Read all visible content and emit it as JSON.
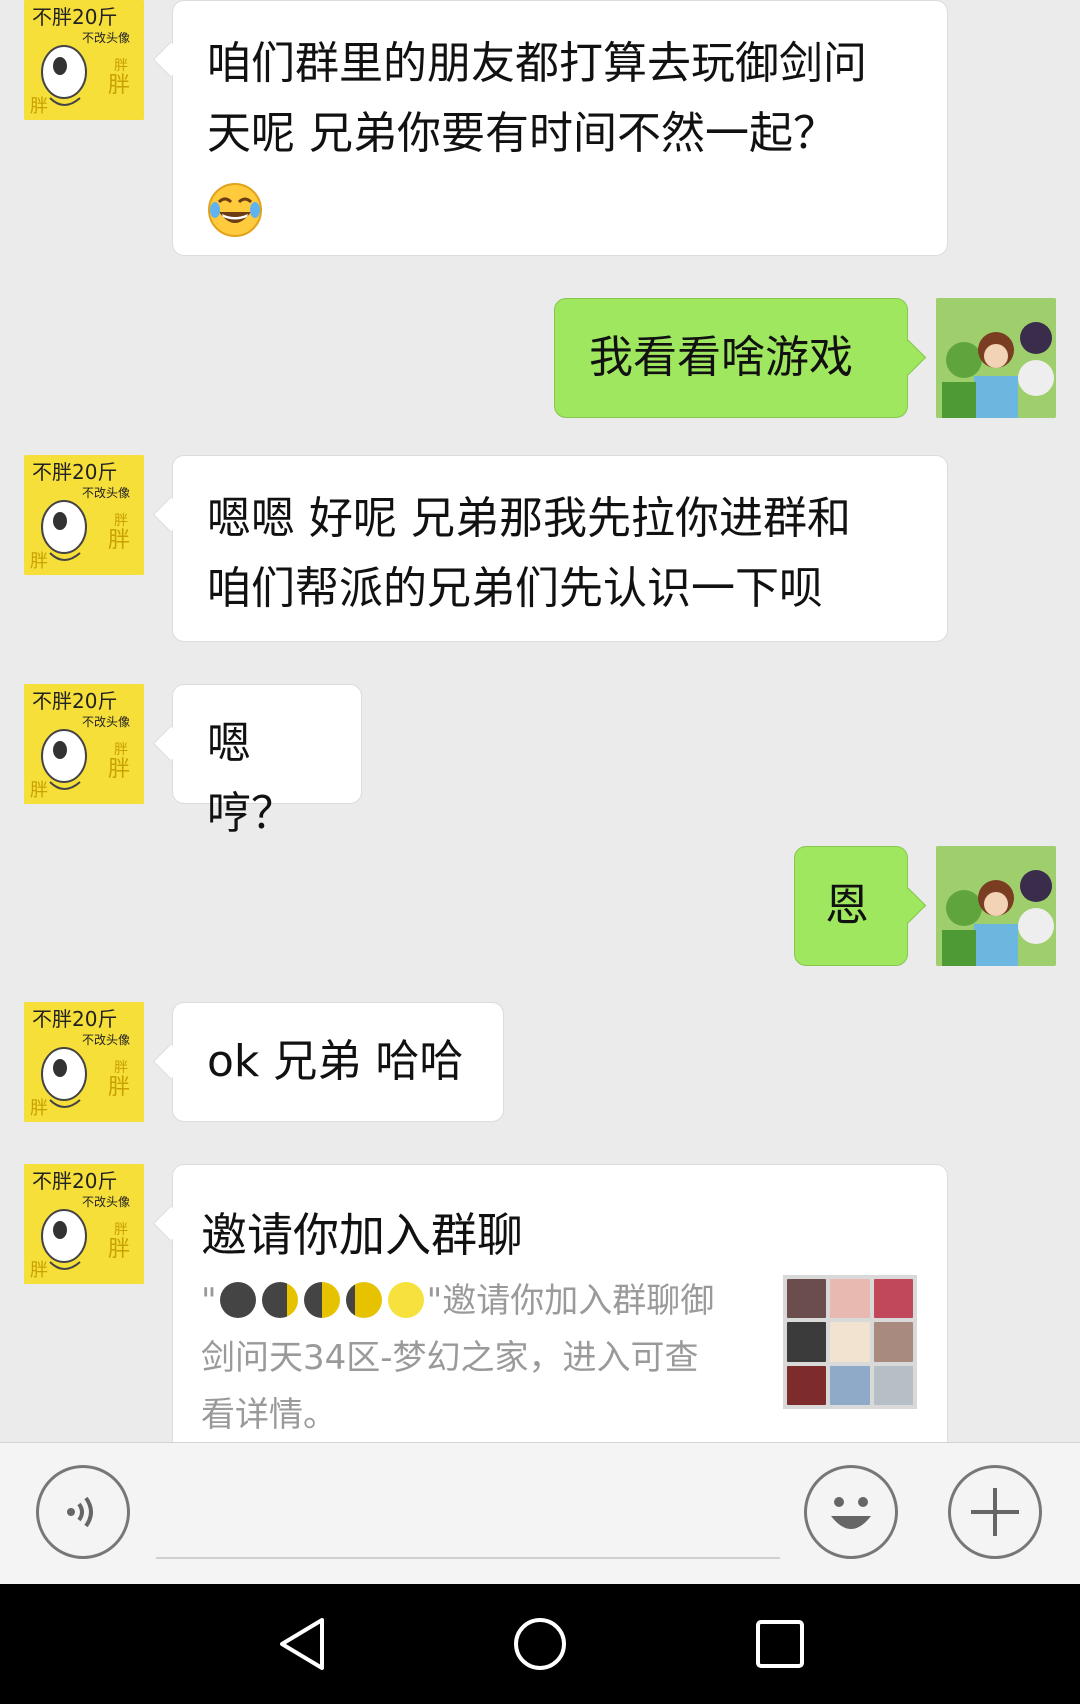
{
  "messages": [
    {
      "sender": "friend",
      "text_line1": "咱们群里的朋友都打算去玩御剑问",
      "text_line2": "天呢  兄弟你要有时间不然一起？",
      "emoji": "face-with-tears-of-joy-icon"
    },
    {
      "sender": "me",
      "text": "我看看啥游戏"
    },
    {
      "sender": "friend",
      "text_line1": "嗯嗯 好呢  兄弟那我先拉你进群和",
      "text_line2": "咱们帮派的兄弟们先认识一下呗"
    },
    {
      "sender": "friend",
      "text": "嗯哼？"
    },
    {
      "sender": "me",
      "text": "恩"
    },
    {
      "sender": "friend",
      "text": "ok 兄弟 哈哈"
    }
  ],
  "friend_avatar": {
    "line1": "不胖20斤",
    "line2": "不改头像",
    "pattern": "胖"
  },
  "invite_card": {
    "title": "邀请你加入群聊",
    "quote_open": "\"",
    "moons": [
      "#444444",
      "#444444",
      "#e6c200",
      "#e6c200",
      "#f7e13c"
    ],
    "desc_part1": "\"邀请你加入群聊御",
    "desc_line2": "剑问天34区-梦幻之家，进入可查",
    "desc_line3": "看详情。"
  },
  "input_bar": {
    "voice_icon": "voice-icon",
    "emoji_icon": "smiley-icon",
    "more_icon": "plus-icon"
  },
  "nav_bar": {
    "back_icon": "back-triangle-icon",
    "home_icon": "home-circle-icon",
    "recent_icon": "recent-square-icon"
  },
  "colors": {
    "outgoing_bubble": "#9ee75e",
    "incoming_bubble": "#ffffff",
    "background": "#ebebeb"
  }
}
